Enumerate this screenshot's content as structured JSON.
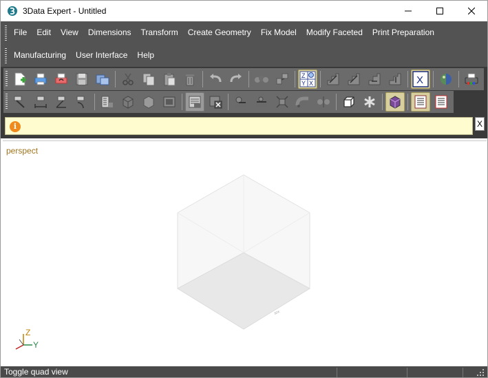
{
  "window": {
    "title": "3Data Expert - Untitled"
  },
  "menu": {
    "row1": [
      "File",
      "Edit",
      "View",
      "Dimensions",
      "Transform",
      "Create Geometry",
      "Fix Model",
      "Modify Faceted",
      "Print Preparation"
    ],
    "row2": [
      "Manufacturing",
      "User Interface",
      "Help"
    ]
  },
  "toolbar": {
    "axis_swap_labels": [
      "Z",
      "Y",
      "X"
    ],
    "x_button_label": "X"
  },
  "message_bar": {
    "icon": "info-icon",
    "text": "",
    "close_label": "X"
  },
  "viewport": {
    "label": "perspect",
    "axis_z": "Z",
    "axis_y": "Y"
  },
  "status": {
    "text": "Toggle quad view"
  },
  "colors": {
    "menu_bg": "#535353",
    "toolbar_bg": "#6b6b6b",
    "message_bg": "#fffcd0",
    "view_label": "#a0741c",
    "status_bg": "#4a4a4a"
  }
}
